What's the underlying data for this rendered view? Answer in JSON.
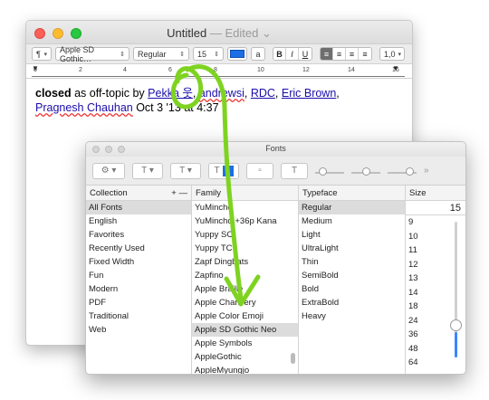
{
  "window": {
    "title": "Untitled",
    "status": "Edited",
    "toolbar": {
      "para_menu": "¶",
      "font_family": "Apple SD Gothic…",
      "font_style": "Regular",
      "font_size": "15",
      "text_color": "#1c6ee6",
      "highlight_btn": "a",
      "bold": "B",
      "italic": "I",
      "underline": "U",
      "spacing": "1,0"
    },
    "ruler": {
      "numbers": [
        "0",
        "2",
        "4",
        "6",
        "8",
        "10",
        "12",
        "14",
        "16"
      ]
    },
    "document": {
      "closed": "closed",
      "as_offtopic": " as off-topic by ",
      "user1": "Pekka 웃",
      "user2": "andrewsi",
      "user3": "RDC",
      "user4": "Eric Brown",
      "user5": "Pragnesh Chauhan",
      "sep": ", ",
      "date": " Oct 3 '13 at 4:37"
    }
  },
  "fonts_panel": {
    "title": "Fonts",
    "collection": {
      "header": "Collection",
      "add": "+",
      "remove": "—",
      "items": [
        "All Fonts",
        "English",
        "Favorites",
        "Recently Used",
        "Fixed Width",
        "Fun",
        "Modern",
        "PDF",
        "Traditional",
        "Web"
      ]
    },
    "family": {
      "header": "Family",
      "items": [
        "YuMincho",
        "YuMincho +36p Kana",
        "Yuppy SC",
        "Yuppy TC",
        "Zapf Dingbats",
        "Zapfino",
        "Apple Braille",
        "Apple Chancery",
        "Apple Color Emoji",
        "Apple SD Gothic Neo",
        "Apple Symbols",
        "AppleGothic",
        "AppleMyungjo"
      ]
    },
    "typeface": {
      "header": "Typeface",
      "items": [
        "Regular",
        "Medium",
        "Light",
        "UltraLight",
        "Thin",
        "SemiBold",
        "Bold",
        "ExtraBold",
        "Heavy"
      ]
    },
    "size": {
      "header": "Size",
      "value": "15",
      "items": [
        "9",
        "10",
        "11",
        "12",
        "13",
        "14",
        "18",
        "24",
        "36",
        "48",
        "64"
      ]
    }
  },
  "annotation": {
    "color": "#7ed321"
  }
}
